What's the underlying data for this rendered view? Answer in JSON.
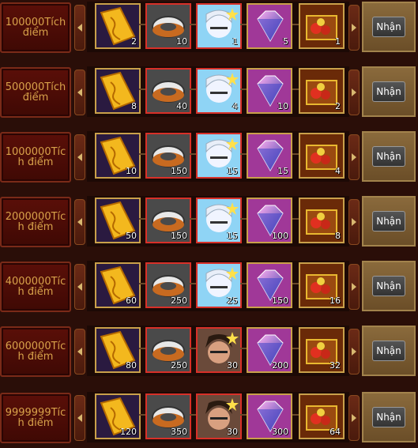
{
  "claim_label": "Nhận",
  "rows": [
    {
      "label": "100000Tích điểm",
      "ticket": "2",
      "ring": "10",
      "avatar": "1",
      "gem": "5",
      "chest": "1",
      "avatar_variant": "light"
    },
    {
      "label": "500000Tích điểm",
      "ticket": "8",
      "ring": "40",
      "avatar": "4",
      "gem": "10",
      "chest": "2",
      "avatar_variant": "light"
    },
    {
      "label": "1000000Tích điểm",
      "ticket": "10",
      "ring": "150",
      "avatar": "15",
      "gem": "15",
      "chest": "4",
      "avatar_variant": "light"
    },
    {
      "label": "2000000Tích điểm",
      "ticket": "50",
      "ring": "150",
      "avatar": "15",
      "gem": "100",
      "chest": "8",
      "avatar_variant": "light"
    },
    {
      "label": "4000000Tích điểm",
      "ticket": "60",
      "ring": "250",
      "avatar": "25",
      "gem": "150",
      "chest": "16",
      "avatar_variant": "light"
    },
    {
      "label": "6000000Tích điểm",
      "ticket": "80",
      "ring": "250",
      "avatar": "30",
      "gem": "200",
      "chest": "32",
      "avatar_variant": "dark"
    },
    {
      "label": "9999999Tích điểm",
      "ticket": "120",
      "ring": "350",
      "avatar": "30",
      "gem": "300",
      "chest": "64",
      "avatar_variant": "dark"
    }
  ]
}
